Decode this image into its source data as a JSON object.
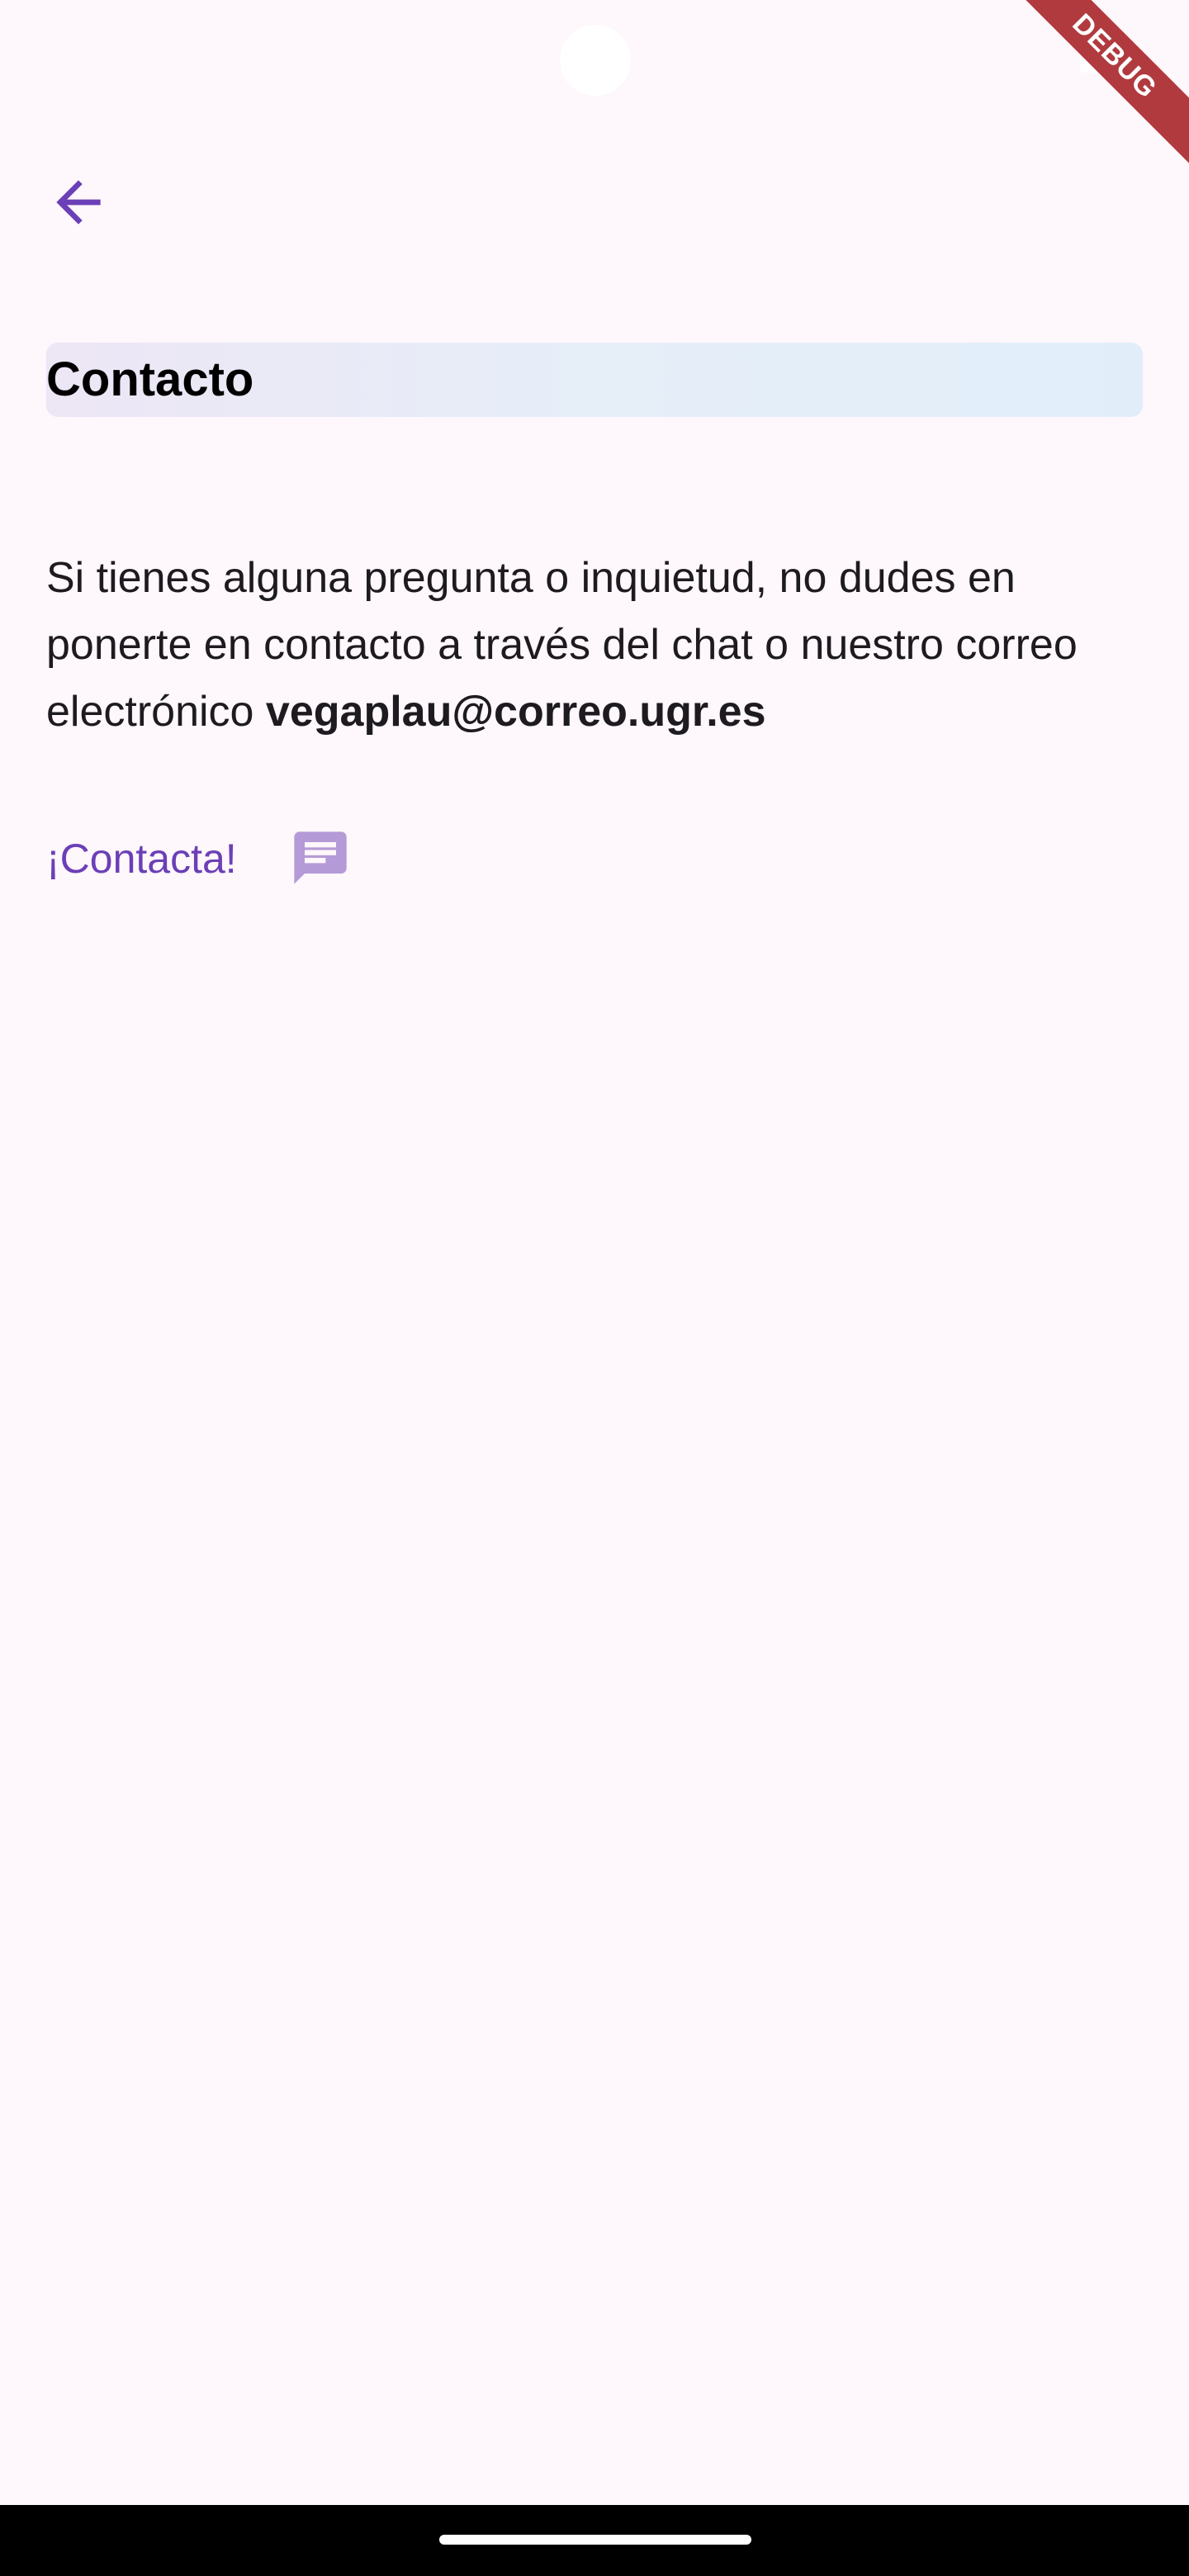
{
  "status_bar": {
    "debug_label": "DEBUG"
  },
  "colors": {
    "background": "#fef7fb",
    "accent": "#6b3fb7",
    "chat_icon": "#b59ad8",
    "title_gradient_start": "#ede6f5",
    "title_gradient_end": "#e1eefa"
  },
  "header": {
    "back_icon": "arrow-back-icon"
  },
  "page": {
    "title": "Contacto",
    "intro_text": "Si tienes alguna pregunta o inquietud, no dudes en ponerte en contacto a través del chat o nuestro correo electrónico ",
    "email": "vegaplau@correo.ugr.es"
  },
  "contact": {
    "link_label": "¡Contacta!",
    "chat_icon": "chat-message-icon"
  }
}
